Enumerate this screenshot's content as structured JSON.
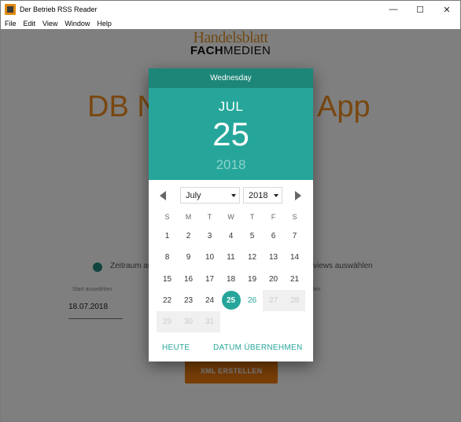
{
  "window": {
    "title": "Der Betrieb RSS Reader",
    "minimize_glyph": "—",
    "maximize_glyph": "☐",
    "close_glyph": "✕"
  },
  "menu": {
    "items": [
      "File",
      "Edit",
      "View",
      "Window",
      "Help"
    ]
  },
  "app": {
    "logo_top": "Handelsblatt",
    "logo_bottom_bold": "FACH",
    "logo_bottom_light": "MEDIEN",
    "title_left": "DB N",
    "title_right": "App",
    "radio_label_left": "Zeitraum au",
    "radio_label_right": "views auswählen",
    "start_label": "Start auswählen",
    "end_label_partial": "len",
    "start_value": "18.07.2018",
    "xml_button": "XML ERSTELLEN",
    "accent_color": "#f28f1e"
  },
  "datepicker": {
    "weekday": "Wednesday",
    "month_short": "JUL",
    "day": "25",
    "year": "2018",
    "month_select": "July",
    "year_select": "2018",
    "weekday_headers": [
      "S",
      "M",
      "T",
      "W",
      "T",
      "F",
      "S"
    ],
    "weeks": [
      [
        {
          "d": "1"
        },
        {
          "d": "2"
        },
        {
          "d": "3"
        },
        {
          "d": "4"
        },
        {
          "d": "5"
        },
        {
          "d": "6"
        },
        {
          "d": "7"
        }
      ],
      [
        {
          "d": "8"
        },
        {
          "d": "9"
        },
        {
          "d": "10"
        },
        {
          "d": "11"
        },
        {
          "d": "12"
        },
        {
          "d": "13"
        },
        {
          "d": "14"
        }
      ],
      [
        {
          "d": "15"
        },
        {
          "d": "16"
        },
        {
          "d": "17"
        },
        {
          "d": "18"
        },
        {
          "d": "19"
        },
        {
          "d": "20"
        },
        {
          "d": "21"
        }
      ],
      [
        {
          "d": "22"
        },
        {
          "d": "23"
        },
        {
          "d": "24"
        },
        {
          "d": "25",
          "state": "selected"
        },
        {
          "d": "26",
          "state": "today"
        },
        {
          "d": "27",
          "state": "disabled"
        },
        {
          "d": "28",
          "state": "disabled"
        }
      ],
      [
        {
          "d": "29",
          "state": "disabled"
        },
        {
          "d": "30",
          "state": "disabled"
        },
        {
          "d": "31",
          "state": "disabled"
        },
        {
          "d": "",
          "state": "empty"
        },
        {
          "d": "",
          "state": "empty"
        },
        {
          "d": "",
          "state": "empty"
        },
        {
          "d": "",
          "state": "empty"
        }
      ]
    ],
    "today_button": "HEUTE",
    "accept_button": "DATUM ÜBERNEHMEN",
    "header_color": "#26a69a",
    "weekday_bar_color": "#1d8678"
  }
}
